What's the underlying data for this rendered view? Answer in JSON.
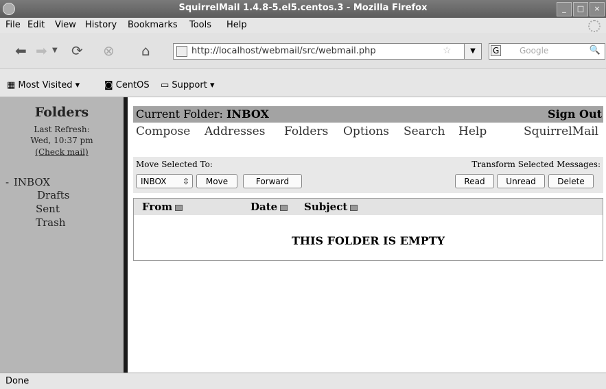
{
  "window": {
    "title": "SquirrelMail 1.4.8-5.el5.centos.3 - Mozilla Firefox"
  },
  "menu": [
    "File",
    "Edit",
    "View",
    "History",
    "Bookmarks",
    "Tools",
    "Help"
  ],
  "nav": {
    "url": "http://localhost/webmail/src/webmail.php",
    "search_placeholder": "Google",
    "search_engine": "G"
  },
  "bookmarks": {
    "most_visited": "Most Visited",
    "centos": "CentOS",
    "support": "Support"
  },
  "sidebar": {
    "title": "Folders",
    "last_refresh_label": "Last Refresh:",
    "last_refresh_time": "Wed, 10:37 pm",
    "check_mail": "(Check mail)",
    "folders": {
      "inbox": "INBOX",
      "inbox_prefix": "-",
      "drafts": "Drafts",
      "sent": "Sent",
      "trash": "Trash"
    }
  },
  "main": {
    "current_folder_label": "Current Folder:",
    "current_folder_name": "INBOX",
    "sign_out": "Sign Out",
    "links": {
      "compose": "Compose",
      "addresses": "Addresses",
      "folders": "Folders",
      "options": "Options",
      "search": "Search",
      "help": "Help",
      "squirrelmail": "SquirrelMail"
    },
    "move_label": "Move Selected To:",
    "transform_label": "Transform Selected Messages:",
    "move_target": "INBOX",
    "buttons": {
      "move": "Move",
      "forward": "Forward",
      "read": "Read",
      "unread": "Unread",
      "delete": "Delete"
    },
    "columns": {
      "from": "From",
      "date": "Date",
      "subject": "Subject"
    },
    "empty_message": "THIS FOLDER IS EMPTY"
  },
  "status": "Done",
  "colors": {
    "sidebar_bg": "#b6b6b6",
    "folder_bar_bg": "#a3a3a3",
    "action_bar_bg": "#e8e8e8"
  }
}
